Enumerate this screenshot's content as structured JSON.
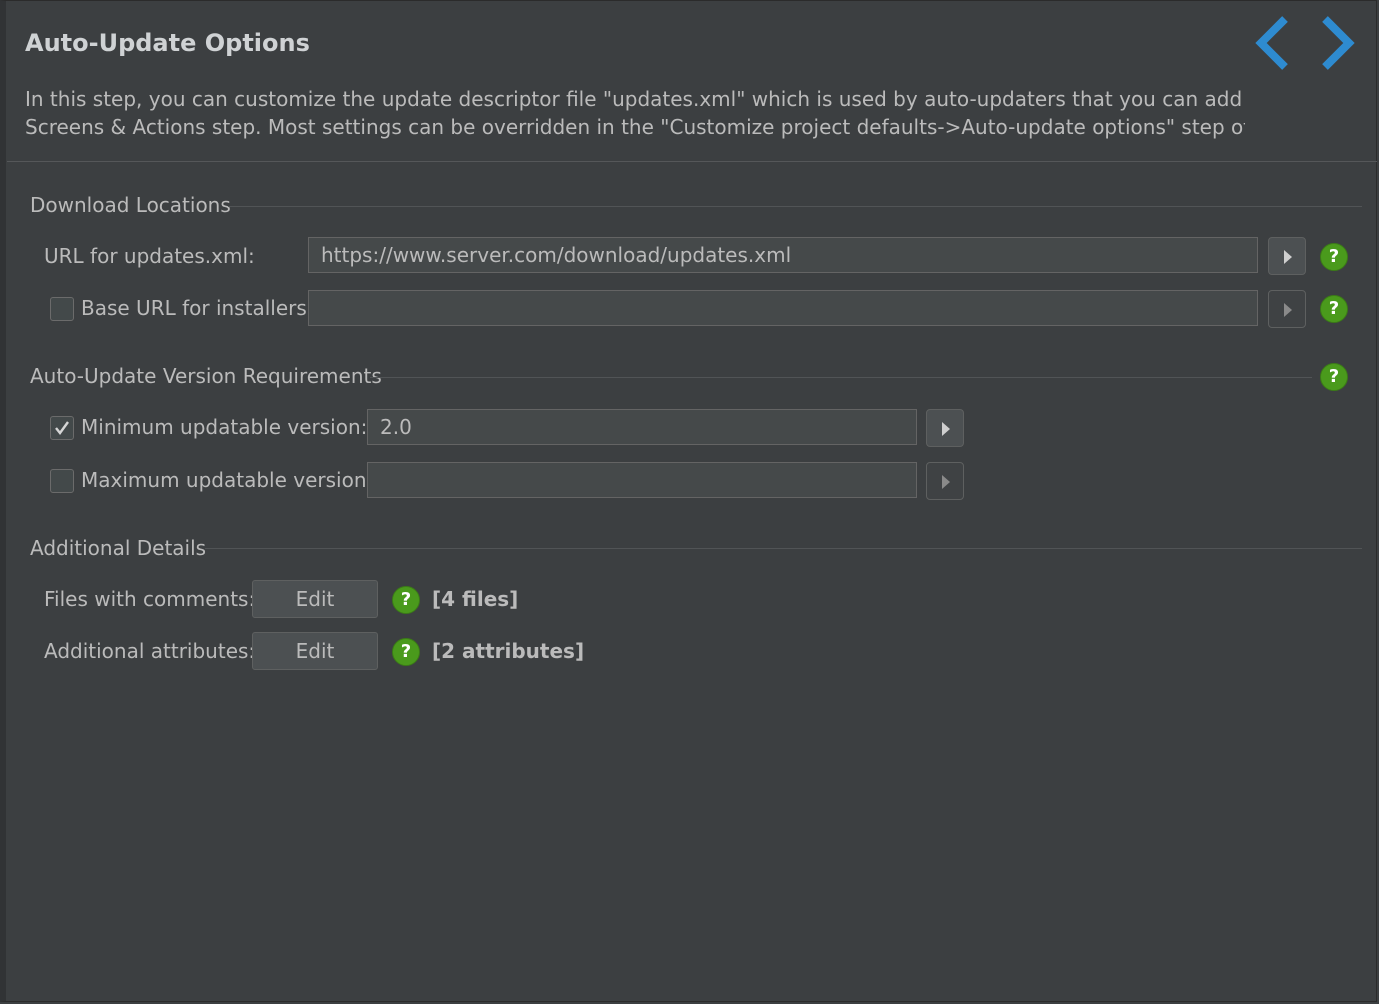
{
  "header": {
    "title": "Auto-Update Options",
    "description_line1": "In this step, you can customize the update descriptor file \"updates.xml\" which is used by auto-updaters that you can add on the",
    "description_line2": "Screens & Actions step. Most settings can be overridden in the \"Customize project defaults->Auto-update options\" step of the",
    "back_icon": "chevron-left-icon",
    "forward_icon": "chevron-right-icon",
    "nav_color": "#2e8bd0"
  },
  "download_locations": {
    "title": "Download Locations",
    "url_label": "URL for updates.xml:",
    "url_value": "https://www.server.com/download/updates.xml",
    "base_url_label": "Base URL for installers:",
    "base_url_value": "",
    "base_url_checked": false
  },
  "version_requirements": {
    "title": "Auto-Update Version Requirements",
    "min_label": "Minimum updatable version:",
    "min_value": "2.0",
    "min_checked": true,
    "max_label": "Maximum updatable version:",
    "max_value": "",
    "max_checked": false
  },
  "additional_details": {
    "title": "Additional Details",
    "files_label": "Files with comments:",
    "files_button": "Edit",
    "files_count": "[4 files]",
    "attributes_label": "Additional attributes:",
    "attributes_button": "Edit",
    "attributes_count": "[2 attributes]"
  },
  "help_symbol": "?",
  "colors": {
    "background": "#3c3f41",
    "help_green": "#4a9a1c",
    "text": "#bbbbbb"
  }
}
